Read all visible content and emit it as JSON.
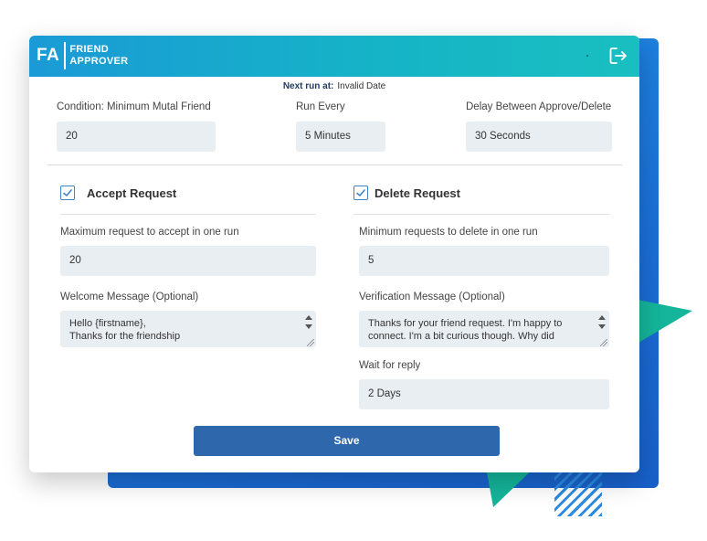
{
  "app": {
    "logo_short": "FA",
    "logo_line1": "FRIEND",
    "logo_line2": "APPROVER"
  },
  "next_run": {
    "label": "Next run at:",
    "value": "Invalid Date"
  },
  "settings": {
    "condition_label": "Condition: Minimum Mutal Friend",
    "condition_value": "20",
    "run_every_label": "Run Every",
    "run_every_value": "5 Minutes",
    "delay_label": "Delay Between Approve/Delete",
    "delay_value": "30 Seconds"
  },
  "accept": {
    "title": "Accept Request",
    "checked": true,
    "max_label": "Maximum request to accept in one run",
    "max_value": "20",
    "welcome_label": "Welcome Message (Optional)",
    "welcome_line1": "Hello {firstname},",
    "welcome_line2": "Thanks for the friendship"
  },
  "delete": {
    "title": "Delete Request",
    "checked": true,
    "min_label": "Minimum requests to delete in one run",
    "min_value": "5",
    "verification_label": "Verification Message (Optional)",
    "verification_line1": "Thanks for your friend request. I'm happy to",
    "verification_line2": "connect. I'm a bit curious though. Why did",
    "wait_label": "Wait for reply",
    "wait_value": "2 Days"
  },
  "actions": {
    "save_label": "Save"
  },
  "colors": {
    "header_start": "#1a9ad6",
    "header_end": "#19bfc0",
    "save_button": "#2f67ad",
    "checkbox": "#3f86c9",
    "backdrop_blue": "#1b6fd6",
    "accent_green": "#16b39a"
  },
  "icons": {
    "logout": "logout-icon",
    "checkbox": "checkmark-icon"
  }
}
